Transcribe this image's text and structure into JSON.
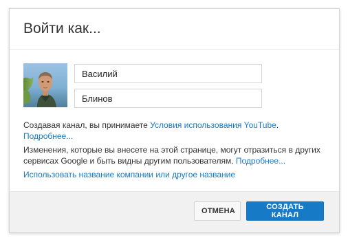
{
  "dialog": {
    "title": "Войти как...",
    "avatar_alt": "Фото профиля"
  },
  "form": {
    "first_name": "Василий",
    "last_name": "Блинов"
  },
  "terms": {
    "prefix": "Создавая канал, вы принимаете ",
    "link": "Условия использования YouTube",
    "suffix": ".",
    "more": "Подробнее..."
  },
  "notice": {
    "text": "Изменения, которые вы внесете на этой странице, могут отразиться в других сервисах Google и быть видны другим пользователям. ",
    "more": "Подробнее..."
  },
  "alt_name_link": "Использовать название компании или другое название",
  "buttons": {
    "cancel": "ОТМЕНА",
    "create": "СОЗДАТЬ КАНАЛ"
  },
  "colors": {
    "link": "#167ac6",
    "primary_button": "#167ac6",
    "footer_bg": "#f1f1f1"
  }
}
